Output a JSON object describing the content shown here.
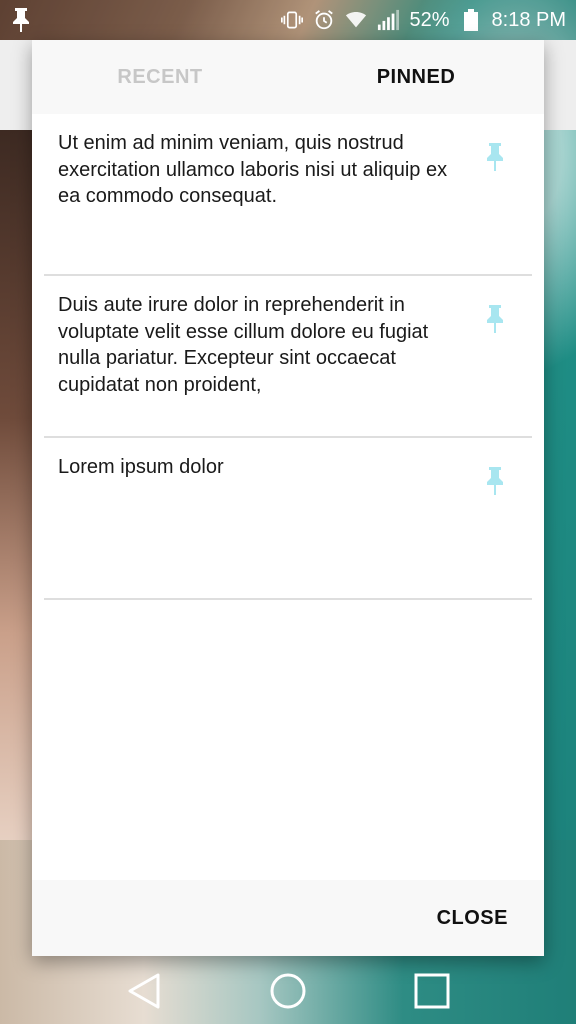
{
  "status_bar": {
    "battery_percent": "52%",
    "time": "8:18 PM",
    "icons": [
      "pin-notification-icon",
      "vibrate-icon",
      "alarm-icon",
      "wifi-icon",
      "signal-icon",
      "battery-icon"
    ]
  },
  "dialog": {
    "tabs": [
      {
        "label": "RECENT",
        "active": false
      },
      {
        "label": "PINNED",
        "active": true
      }
    ],
    "items": [
      {
        "text": "Ut enim ad minim veniam, quis nostrud exercitation ullamco laboris nisi ut aliquip ex ea commodo consequat.",
        "icon": "pin-icon"
      },
      {
        "text": "Duis aute irure dolor in reprehenderit in voluptate velit esse cillum dolore eu fugiat nulla pariatur. Excepteur sint occaecat cupidatat non proident,",
        "icon": "pin-icon"
      },
      {
        "text": "Lorem ipsum dolor",
        "icon": "pin-icon"
      }
    ],
    "close_label": "CLOSE"
  },
  "colors": {
    "pin_icon": "#a8e6f0",
    "tab_inactive": "#c7c7c7",
    "tab_active": "#111111"
  },
  "nav_bar": {
    "icons": [
      "back-icon",
      "home-icon",
      "recents-icon"
    ]
  }
}
